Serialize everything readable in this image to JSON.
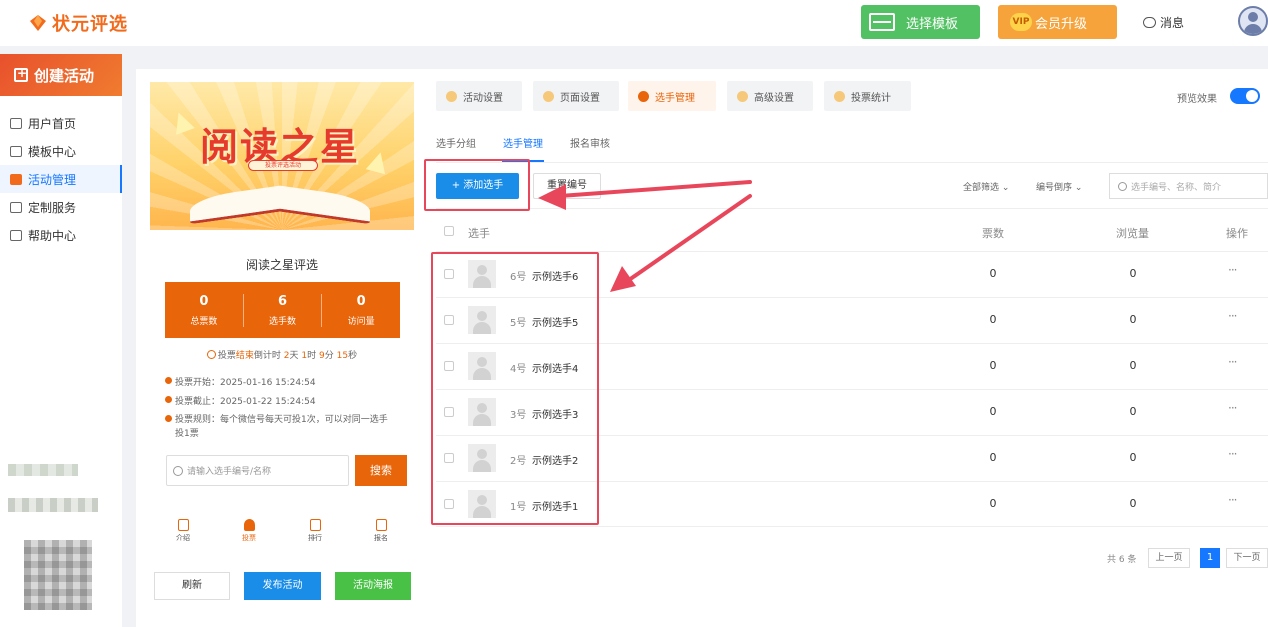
{
  "header": {
    "logo_text": "状元评选",
    "template_btn": "选择模板",
    "vip_badge": "VIP",
    "vip_btn": "会员升级",
    "messages": "消息"
  },
  "sidebar": {
    "create_label": "创建活动",
    "items": [
      {
        "label": "用户首页",
        "icon": "home-icon"
      },
      {
        "label": "模板中心",
        "icon": "folder-icon"
      },
      {
        "label": "活动管理",
        "icon": "ticket-icon"
      },
      {
        "label": "定制服务",
        "icon": "service-icon"
      },
      {
        "label": "帮助中心",
        "icon": "help-icon"
      }
    ],
    "active_index": 2
  },
  "preview": {
    "poster_title": "阅读之星",
    "poster_sub": "投票评选活动",
    "activity_name": "阅读之星评选",
    "stats": [
      {
        "value": "0",
        "label": "总票数"
      },
      {
        "value": "6",
        "label": "选手数"
      },
      {
        "value": "0",
        "label": "访问量"
      }
    ],
    "countdown": {
      "prefix": "投票",
      "end": "结束",
      "mid": "倒计时",
      "days": "2",
      "days_unit": "天",
      "hours": "1",
      "hours_unit": "时",
      "minutes": "9",
      "minutes_unit": "分",
      "seconds": "15",
      "seconds_unit": "秒"
    },
    "info": [
      "投票开始：2025-01-16 15:24:54",
      "投票截止：2025-01-22 15:24:54",
      "投票规则：每个微信号每天可投1次，可以对同一选手投1票"
    ],
    "search_placeholder": "请输入选手编号/名称",
    "search_btn": "搜索",
    "tabbar": [
      {
        "label": "介绍",
        "icon": "intro-icon"
      },
      {
        "label": "投票",
        "icon": "vote-icon"
      },
      {
        "label": "排行",
        "icon": "rank-icon"
      },
      {
        "label": "报名",
        "icon": "signup-icon"
      }
    ],
    "buttons": {
      "refresh": "刷新",
      "publish": "发布活动",
      "poster": "活动海报"
    }
  },
  "main": {
    "tabs": [
      {
        "label": "活动设置",
        "icon": "settings-icon"
      },
      {
        "label": "页面设置",
        "icon": "page-icon"
      },
      {
        "label": "选手管理",
        "icon": "contestant-icon"
      },
      {
        "label": "高级设置",
        "icon": "advanced-icon"
      },
      {
        "label": "投票统计",
        "icon": "stats-icon"
      }
    ],
    "active_tab": 2,
    "preview_label": "预览效果",
    "preview_on": true,
    "subtabs": [
      "选手分组",
      "选手管理",
      "报名审核"
    ],
    "active_subtab": 1,
    "add_btn": "+ 添加选手",
    "reset_btn": "重置编号",
    "filter_all": "全部筛选 ⌄",
    "filter_sort": "编号倒序 ⌄",
    "search_placeholder": "选手编号、名称、简介",
    "columns": [
      "选手",
      "票数",
      "浏览量",
      "操作"
    ],
    "rows": [
      {
        "no": "6号",
        "name": "示例选手6",
        "votes": "0",
        "views": "0"
      },
      {
        "no": "5号",
        "name": "示例选手5",
        "votes": "0",
        "views": "0"
      },
      {
        "no": "4号",
        "name": "示例选手4",
        "votes": "0",
        "views": "0"
      },
      {
        "no": "3号",
        "name": "示例选手3",
        "votes": "0",
        "views": "0"
      },
      {
        "no": "2号",
        "name": "示例选手2",
        "votes": "0",
        "views": "0"
      },
      {
        "no": "1号",
        "name": "示例选手1",
        "votes": "0",
        "views": "0"
      }
    ],
    "more_label": "···",
    "pager": {
      "total": "共 6 条",
      "prev": "上一页",
      "current": "1",
      "next": "下一页"
    }
  },
  "colors": {
    "brand": "#f26b1d",
    "primary": "#1a8de8",
    "annotation": "#e8475b",
    "success": "#52c163",
    "vip": "#f5a33a"
  }
}
